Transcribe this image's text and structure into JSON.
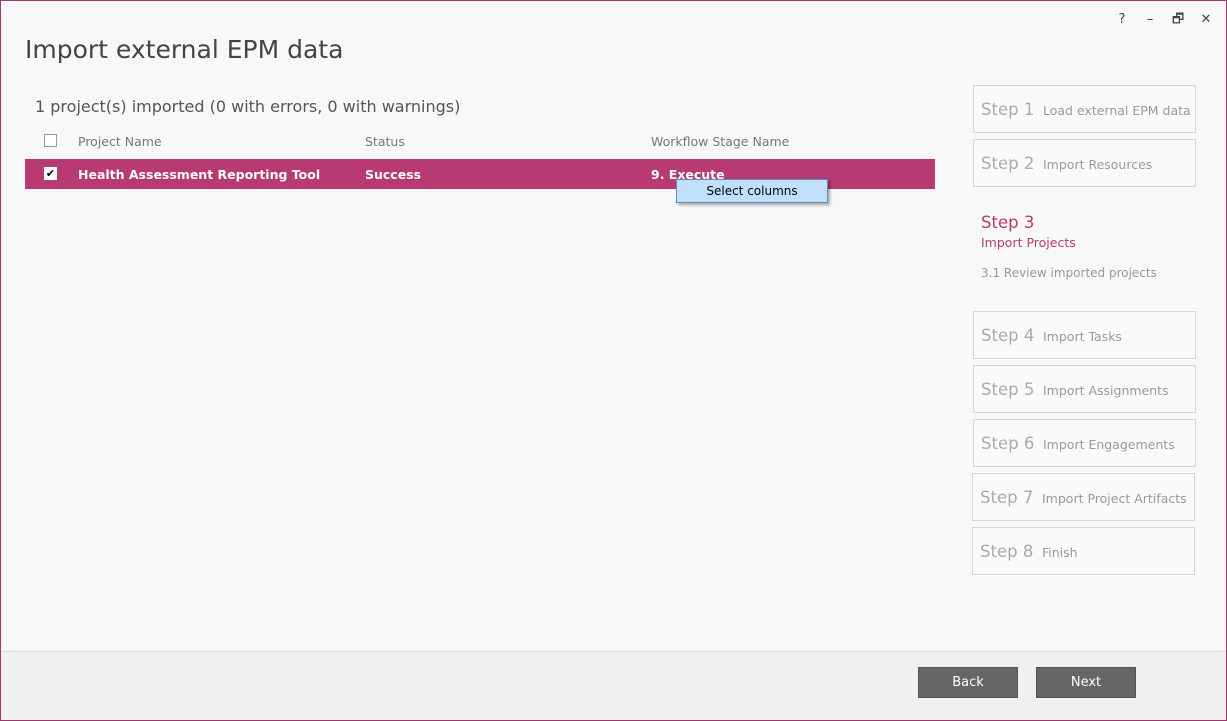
{
  "window": {
    "help": "?",
    "minimize": "–",
    "restore": "🗗",
    "close": "✕"
  },
  "title": "Import external EPM data",
  "summary": "1 project(s) imported (0 with errors, 0 with warnings)",
  "grid": {
    "columns": [
      "Project Name",
      "Status",
      "Workflow Stage Name"
    ],
    "rows": [
      {
        "checked": true,
        "name": "Health Assessment Reporting Tool",
        "status": "Success",
        "stage": "9. Execute"
      }
    ]
  },
  "context_menu": {
    "item": "Select columns"
  },
  "steps": [
    {
      "num": "Step 1",
      "label": "Load external EPM data"
    },
    {
      "num": "Step 2",
      "label": "Import Resources"
    },
    {
      "num": "Step 3",
      "label": "Import Projects",
      "sub": "3.1 Review imported projects",
      "active": true
    },
    {
      "num": "Step 4",
      "label": "Import Tasks"
    },
    {
      "num": "Step 5",
      "label": "Import Assignments"
    },
    {
      "num": "Step 6",
      "label": "Import Engagements"
    },
    {
      "num": "Step 7",
      "label": "Import Project Artifacts"
    },
    {
      "num": "Step 8",
      "label": "Finish"
    }
  ],
  "footer": {
    "back": "Back",
    "next": "Next"
  },
  "colors": {
    "accent": "#b93a72",
    "button": "#666666",
    "context_menu": "#bfe0f8"
  }
}
